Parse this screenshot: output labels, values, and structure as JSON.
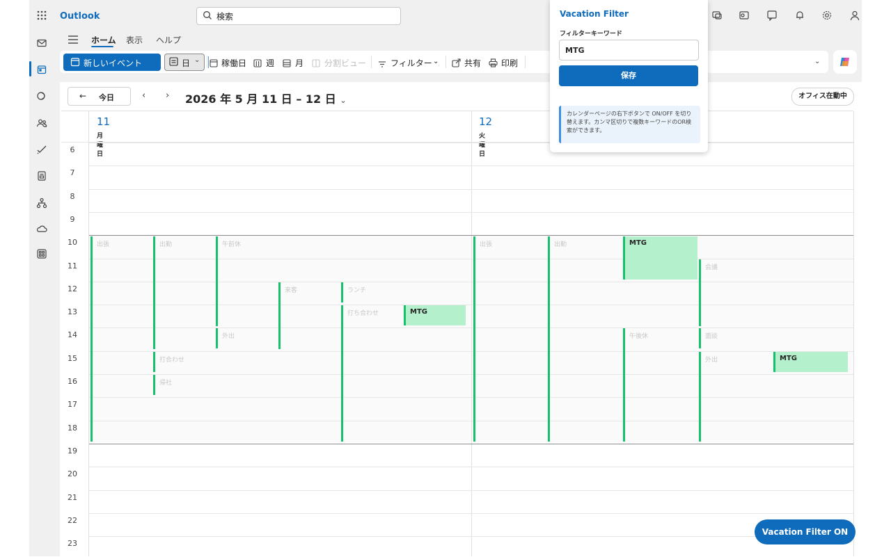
{
  "app": {
    "brand": "Outlook"
  },
  "search": {
    "placeholder": "検索"
  },
  "ribbon": {
    "tabs": [
      "ホーム",
      "表示",
      "ヘルプ"
    ],
    "active_tab": "ホーム"
  },
  "toolbar": {
    "new_event": "新しいイベント",
    "day": "日",
    "work_week": "稼働日",
    "week": "週",
    "month": "月",
    "split_view": "分割ビュー",
    "filter": "フィルター",
    "share": "共有",
    "print": "印刷"
  },
  "calendar": {
    "today": "今日",
    "date_range": "2026 年 5 月 11 日 – 12 日",
    "office_status": "オフィス在動中",
    "days": [
      {
        "number": "11",
        "weekday": "月曜日"
      },
      {
        "number": "12",
        "weekday": "火曜日"
      }
    ],
    "hours": [
      "6",
      "7",
      "8",
      "9",
      "10",
      "11",
      "12",
      "13",
      "14",
      "15",
      "16",
      "17",
      "18",
      "19",
      "20",
      "21",
      "22",
      "23"
    ],
    "events": [
      {
        "title": "出張",
        "highlight": false
      },
      {
        "title": "出勤",
        "highlight": false
      },
      {
        "title": "午前休",
        "highlight": false
      },
      {
        "title": "来客",
        "highlight": false
      },
      {
        "title": "ランチ",
        "highlight": false
      },
      {
        "title": "MTG",
        "highlight": true
      },
      {
        "title": "外出",
        "highlight": false
      },
      {
        "title": "打合わせ",
        "highlight": false
      },
      {
        "title": "帰社",
        "highlight": false
      },
      {
        "title": "打ち合わせ",
        "highlight": false
      },
      {
        "title": "出張",
        "highlight": false
      },
      {
        "title": "出勤",
        "highlight": false
      },
      {
        "title": "MTG",
        "highlight": true
      },
      {
        "title": "会議",
        "highlight": false
      },
      {
        "title": "午後休",
        "highlight": false
      },
      {
        "title": "面談",
        "highlight": false
      },
      {
        "title": "外出",
        "highlight": false
      },
      {
        "title": "MTG",
        "highlight": true
      }
    ]
  },
  "popup": {
    "title": "Vacation Filter",
    "keyword_label": "フィルターキーワード",
    "keyword_value": "MTG",
    "save": "保存",
    "note": "カレンダーページの右下ボタンで ON/OFF を切り替えます。カンマ区切りで複数キーワードのOR検索ができます。"
  },
  "vacation_button": "Vacation Filter ON",
  "colors": {
    "accent": "#0f6cbd",
    "event_bar": "#15c26b",
    "event_highlight": "#b4f0cc"
  }
}
